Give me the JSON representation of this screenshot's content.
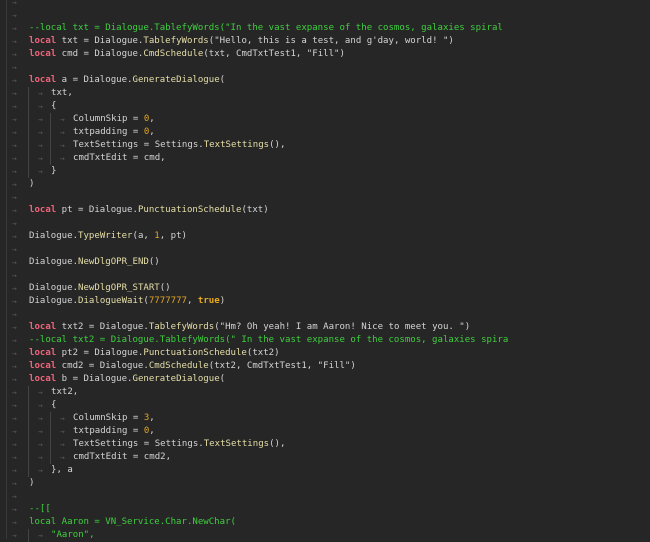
{
  "colors": {
    "background": "#262626",
    "keyword": "#f0647a",
    "identifier": "#d4d4d4",
    "method": "#e6dfa8",
    "number": "#e0a526",
    "comment": "#3fcf3f"
  },
  "tab_icon": "tab-arrow-icon",
  "lines": [
    {
      "indent": 0,
      "tokens": []
    },
    {
      "indent": 0,
      "tokens": []
    },
    {
      "indent": 0,
      "tokens": [
        [
          "c",
          "--local txt = Dialogue.TablefyWords(\"In the vast expanse of the cosmos, galaxies spiral"
        ]
      ]
    },
    {
      "indent": 0,
      "tokens": [
        [
          "k",
          "local"
        ],
        [
          "i",
          " txt = Dialogue."
        ],
        [
          "f",
          "TablefyWords"
        ],
        [
          "i",
          "(\"Hello, this is a test, and g'day, world! \")"
        ]
      ]
    },
    {
      "indent": 0,
      "tokens": [
        [
          "k",
          "local"
        ],
        [
          "i",
          " cmd = Dialogue."
        ],
        [
          "f",
          "CmdSchedule"
        ],
        [
          "i",
          "(txt, CmdTxtTest1, \"Fill\")"
        ]
      ]
    },
    {
      "indent": 0,
      "tokens": []
    },
    {
      "indent": 0,
      "tokens": [
        [
          "k",
          "local"
        ],
        [
          "i",
          " a = Dialogue."
        ],
        [
          "f",
          "GenerateDialogue"
        ],
        [
          "i",
          "("
        ]
      ]
    },
    {
      "indent": 1,
      "tokens": [
        [
          "i",
          "txt,"
        ]
      ]
    },
    {
      "indent": 1,
      "tokens": [
        [
          "i",
          "{"
        ]
      ]
    },
    {
      "indent": 2,
      "tokens": [
        [
          "i",
          "ColumnSkip = "
        ],
        [
          "n",
          "0"
        ],
        [
          "i",
          ","
        ]
      ]
    },
    {
      "indent": 2,
      "tokens": [
        [
          "i",
          "txtpadding = "
        ],
        [
          "n",
          "0"
        ],
        [
          "i",
          ","
        ]
      ]
    },
    {
      "indent": 2,
      "tokens": [
        [
          "i",
          "TextSettings = Settings."
        ],
        [
          "f",
          "TextSettings"
        ],
        [
          "i",
          "(),"
        ]
      ]
    },
    {
      "indent": 2,
      "tokens": [
        [
          "i",
          "cmdTxtEdit = cmd,"
        ]
      ]
    },
    {
      "indent": 1,
      "tokens": [
        [
          "i",
          "}"
        ]
      ]
    },
    {
      "indent": 0,
      "tokens": [
        [
          "i",
          ")"
        ]
      ]
    },
    {
      "indent": 0,
      "tokens": []
    },
    {
      "indent": 0,
      "tokens": [
        [
          "k",
          "local"
        ],
        [
          "i",
          " pt = Dialogue."
        ],
        [
          "f",
          "PunctuationSchedule"
        ],
        [
          "i",
          "(txt)"
        ]
      ]
    },
    {
      "indent": 0,
      "tokens": []
    },
    {
      "indent": 0,
      "tokens": [
        [
          "i",
          "Dialogue."
        ],
        [
          "f",
          "TypeWriter"
        ],
        [
          "i",
          "(a, "
        ],
        [
          "n",
          "1"
        ],
        [
          "i",
          ", pt)"
        ]
      ]
    },
    {
      "indent": 0,
      "tokens": []
    },
    {
      "indent": 0,
      "tokens": [
        [
          "i",
          "Dialogue."
        ],
        [
          "f",
          "NewDlgOPR_END"
        ],
        [
          "i",
          "()"
        ]
      ]
    },
    {
      "indent": 0,
      "tokens": []
    },
    {
      "indent": 0,
      "tokens": [
        [
          "i",
          "Dialogue."
        ],
        [
          "f",
          "NewDlgOPR_START"
        ],
        [
          "i",
          "()"
        ]
      ]
    },
    {
      "indent": 0,
      "tokens": [
        [
          "i",
          "Dialogue."
        ],
        [
          "f",
          "DialogueWait"
        ],
        [
          "i",
          "("
        ],
        [
          "n",
          "7777777"
        ],
        [
          "i",
          ", "
        ],
        [
          "b",
          "true"
        ],
        [
          "i",
          ")"
        ]
      ]
    },
    {
      "indent": 0,
      "tokens": []
    },
    {
      "indent": 0,
      "tokens": [
        [
          "k",
          "local"
        ],
        [
          "i",
          " txt2 = Dialogue."
        ],
        [
          "f",
          "TablefyWords"
        ],
        [
          "i",
          "(\"Hm? Oh yeah! I am Aaron! Nice to meet you. \")"
        ]
      ]
    },
    {
      "indent": 0,
      "tokens": [
        [
          "c",
          "--local txt2 = Dialogue.TablefyWords(\" In the vast expanse of the cosmos, galaxies spira"
        ]
      ]
    },
    {
      "indent": 0,
      "tokens": [
        [
          "k",
          "local"
        ],
        [
          "i",
          " pt2 = Dialogue."
        ],
        [
          "f",
          "PunctuationSchedule"
        ],
        [
          "i",
          "(txt2)"
        ]
      ]
    },
    {
      "indent": 0,
      "tokens": [
        [
          "k",
          "local"
        ],
        [
          "i",
          " cmd2 = Dialogue."
        ],
        [
          "f",
          "CmdSchedule"
        ],
        [
          "i",
          "(txt2, CmdTxtTest1, \"Fill\")"
        ]
      ]
    },
    {
      "indent": 0,
      "tokens": [
        [
          "k",
          "local"
        ],
        [
          "i",
          " b = Dialogue."
        ],
        [
          "f",
          "GenerateDialogue"
        ],
        [
          "i",
          "("
        ]
      ]
    },
    {
      "indent": 1,
      "tokens": [
        [
          "i",
          "txt2,"
        ]
      ]
    },
    {
      "indent": 1,
      "tokens": [
        [
          "i",
          "{"
        ]
      ]
    },
    {
      "indent": 2,
      "tokens": [
        [
          "i",
          "ColumnSkip = "
        ],
        [
          "n",
          "3"
        ],
        [
          "i",
          ","
        ]
      ]
    },
    {
      "indent": 2,
      "tokens": [
        [
          "i",
          "txtpadding = "
        ],
        [
          "n",
          "0"
        ],
        [
          "i",
          ","
        ]
      ]
    },
    {
      "indent": 2,
      "tokens": [
        [
          "i",
          "TextSettings = Settings."
        ],
        [
          "f",
          "TextSettings"
        ],
        [
          "i",
          "(),"
        ]
      ]
    },
    {
      "indent": 2,
      "tokens": [
        [
          "i",
          "cmdTxtEdit = cmd2,"
        ]
      ]
    },
    {
      "indent": 1,
      "tokens": [
        [
          "i",
          "}, a"
        ]
      ]
    },
    {
      "indent": 0,
      "tokens": [
        [
          "i",
          ")"
        ]
      ]
    },
    {
      "indent": 0,
      "tokens": []
    },
    {
      "indent": 0,
      "tokens": [
        [
          "c",
          "--[["
        ]
      ]
    },
    {
      "indent": 0,
      "tokens": [
        [
          "c",
          "local Aaron = VN_Service.Char.NewChar("
        ]
      ]
    },
    {
      "indent": 1,
      "tokens": [
        [
          "c",
          "\"Aaron\","
        ]
      ]
    }
  ]
}
